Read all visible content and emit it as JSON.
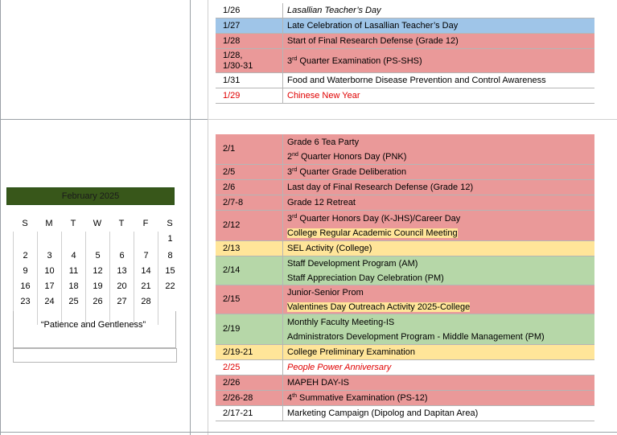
{
  "january": [
    {
      "date": "1/26",
      "lines": [
        {
          "text": "Lasallian Teacher’s Day",
          "style": "it"
        }
      ],
      "color": "white"
    },
    {
      "date": "1/27",
      "lines": [
        {
          "text": "Late Celebration of Lasallian Teacher’s Day"
        }
      ],
      "color": "blue"
    },
    {
      "date": "1/28",
      "lines": [
        {
          "text": "Start of Final Research Defense (Grade 12)"
        }
      ],
      "color": "pink"
    },
    {
      "date": "1/28,\n1/30-31",
      "lines": [
        {
          "html": "3<sup>rd</sup> Quarter Examination (PS-SHS)"
        }
      ],
      "color": "pink"
    },
    {
      "date": "1/31",
      "lines": [
        {
          "text": "Food and Waterborne Disease Prevention and Control Awareness"
        }
      ],
      "color": "white"
    },
    {
      "date": "1/29",
      "lines": [
        {
          "text": "Chinese New Year",
          "style": "red"
        }
      ],
      "color": "white",
      "date_red": true
    }
  ],
  "february": [
    {
      "date": "2/1",
      "lines": [
        {
          "text": "Grade 6 Tea Party"
        },
        {
          "html": "2<sup>nd</sup> Quarter Honors Day (PNK)"
        }
      ],
      "color": "pink"
    },
    {
      "date": "2/5",
      "lines": [
        {
          "html": "3<sup>rd</sup> Quarter Grade Deliberation"
        }
      ],
      "color": "pink"
    },
    {
      "date": "2/6",
      "lines": [
        {
          "text": "Last day of Final Research Defense (Grade 12)"
        }
      ],
      "color": "pink"
    },
    {
      "date": "2/7-8",
      "lines": [
        {
          "text": "Grade 12 Retreat"
        }
      ],
      "color": "pink"
    },
    {
      "date": "2/12",
      "lines": [
        {
          "html": "3<sup>rd</sup> Quarter Honors Day (K-JHS)/Career Day"
        },
        {
          "text": "College Regular Academic Council Meeting",
          "hl": true
        }
      ],
      "color": "pink"
    },
    {
      "date": "2/13",
      "lines": [
        {
          "text": "SEL Activity (College)"
        }
      ],
      "color": "yellow"
    },
    {
      "date": "2/14",
      "lines": [
        {
          "text": "Staff Development Program (AM)"
        },
        {
          "text": "Staff Appreciation Day Celebration (PM)"
        }
      ],
      "color": "green"
    },
    {
      "date": "2/15",
      "lines": [
        {
          "text": "Junior-Senior Prom"
        },
        {
          "text": "Valentines Day Outreach Activity 2025-College",
          "hl": true
        }
      ],
      "color": "pink"
    },
    {
      "date": "2/19",
      "lines": [
        {
          "text": "Monthly Faculty Meeting-IS"
        },
        {
          "text": "Administrators Development Program - Middle Management (PM)"
        }
      ],
      "color": "green"
    },
    {
      "date": "2/19-21",
      "lines": [
        {
          "text": "College Preliminary Examination"
        }
      ],
      "color": "yellow"
    },
    {
      "date": "2/25",
      "lines": [
        {
          "text": "People Power Anniversary",
          "style": "it red"
        }
      ],
      "color": "white",
      "date_red": true
    },
    {
      "date": "2/26",
      "lines": [
        {
          "text": "MAPEH DAY-IS"
        }
      ],
      "color": "pink"
    },
    {
      "date": "2/26-28",
      "lines": [
        {
          "html": "4<sup>th</sup> Summative Examination (PS-12)"
        }
      ],
      "color": "pink"
    },
    {
      "date": "2/17-21",
      "lines": [
        {
          "text": "Marketing Campaign (Dipolog and Dapitan Area)"
        }
      ],
      "color": "white"
    }
  ],
  "calendar": {
    "title": "February 2025",
    "weekdays": [
      "S",
      "M",
      "T",
      "W",
      "T",
      "F",
      "S"
    ],
    "weeks": [
      [
        "",
        "",
        "",
        "",
        "",
        "",
        "1"
      ],
      [
        "2",
        "3",
        "4",
        "5",
        "6",
        "7",
        "8"
      ],
      [
        "9",
        "10",
        "11",
        "12",
        "13",
        "14",
        "15"
      ],
      [
        "16",
        "17",
        "18",
        "19",
        "20",
        "21",
        "22"
      ],
      [
        "23",
        "24",
        "25",
        "26",
        "27",
        "28",
        ""
      ]
    ],
    "motto": "“Patience and Gentleness”"
  }
}
